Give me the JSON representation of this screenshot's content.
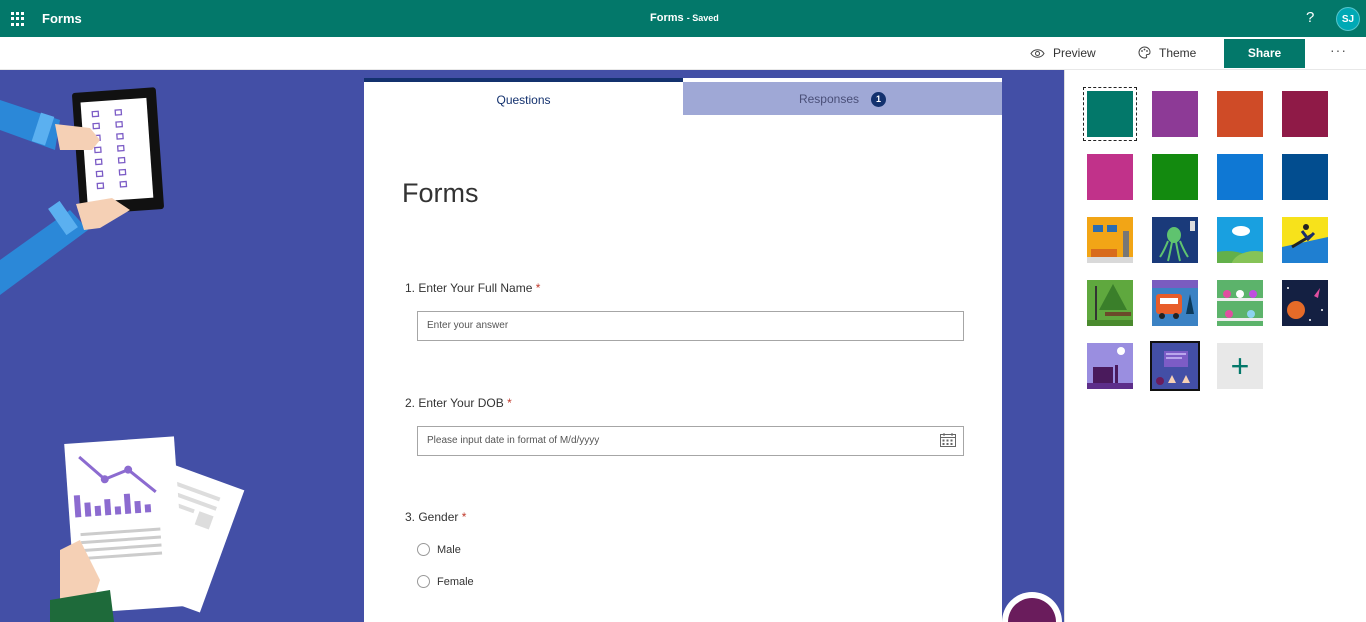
{
  "topbar": {
    "app_name": "Forms",
    "doc_title": "Forms",
    "doc_status": "Saved",
    "help": "?",
    "avatar_initials": "SJ",
    "color": "#03786a"
  },
  "commandbar": {
    "preview_label": "Preview",
    "theme_label": "Theme",
    "share_label": "Share",
    "more_label": "···"
  },
  "tabs": {
    "questions_label": "Questions",
    "responses_label": "Responses",
    "responses_count": "1"
  },
  "form": {
    "title": "Forms",
    "questions": [
      {
        "label": "1. Enter Your Full Name",
        "required": "*",
        "placeholder": "Enter your answer"
      },
      {
        "label": "2. Enter Your DOB",
        "required": "*",
        "placeholder": "Please input date in format of M/d/yyyy"
      },
      {
        "label": "3. Gender",
        "required": "*",
        "options": [
          "Male",
          "Female"
        ]
      }
    ]
  },
  "theme_panel": {
    "solid_colors": [
      "#03786a",
      "#8d3a96",
      "#cf4b27",
      "#8f1a47",
      "#c1328a",
      "#138a0f",
      "#0f78d4",
      "#024d8f"
    ],
    "selected_color": "#03786a",
    "image_themes": [
      "living-room",
      "octopus",
      "cloud-hills",
      "snowboarder",
      "park-bench",
      "food-truck",
      "science-lab",
      "space-rocket",
      "desk-clock",
      "presentation-hands"
    ],
    "selected_image": "presentation-hands",
    "add_label": "+"
  },
  "canvas": {
    "background": "#434fa6"
  }
}
